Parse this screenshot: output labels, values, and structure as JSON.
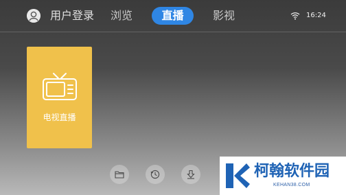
{
  "header": {
    "login_label": "用户登录",
    "tabs": [
      {
        "label": "浏览",
        "active": false
      },
      {
        "label": "直播",
        "active": true
      },
      {
        "label": "影视",
        "active": false
      }
    ],
    "time": "16:24",
    "accent_color": "#2f86e4"
  },
  "tile": {
    "label": "电视直播",
    "color": "#f0c14b",
    "icon": "tv-icon"
  },
  "bottom_buttons": [
    {
      "icon": "folder-icon"
    },
    {
      "icon": "history-icon"
    },
    {
      "icon": "download-icon"
    }
  ],
  "watermark": {
    "title": "柯翰软件园",
    "subtitle": "KEHAN38.COM"
  }
}
